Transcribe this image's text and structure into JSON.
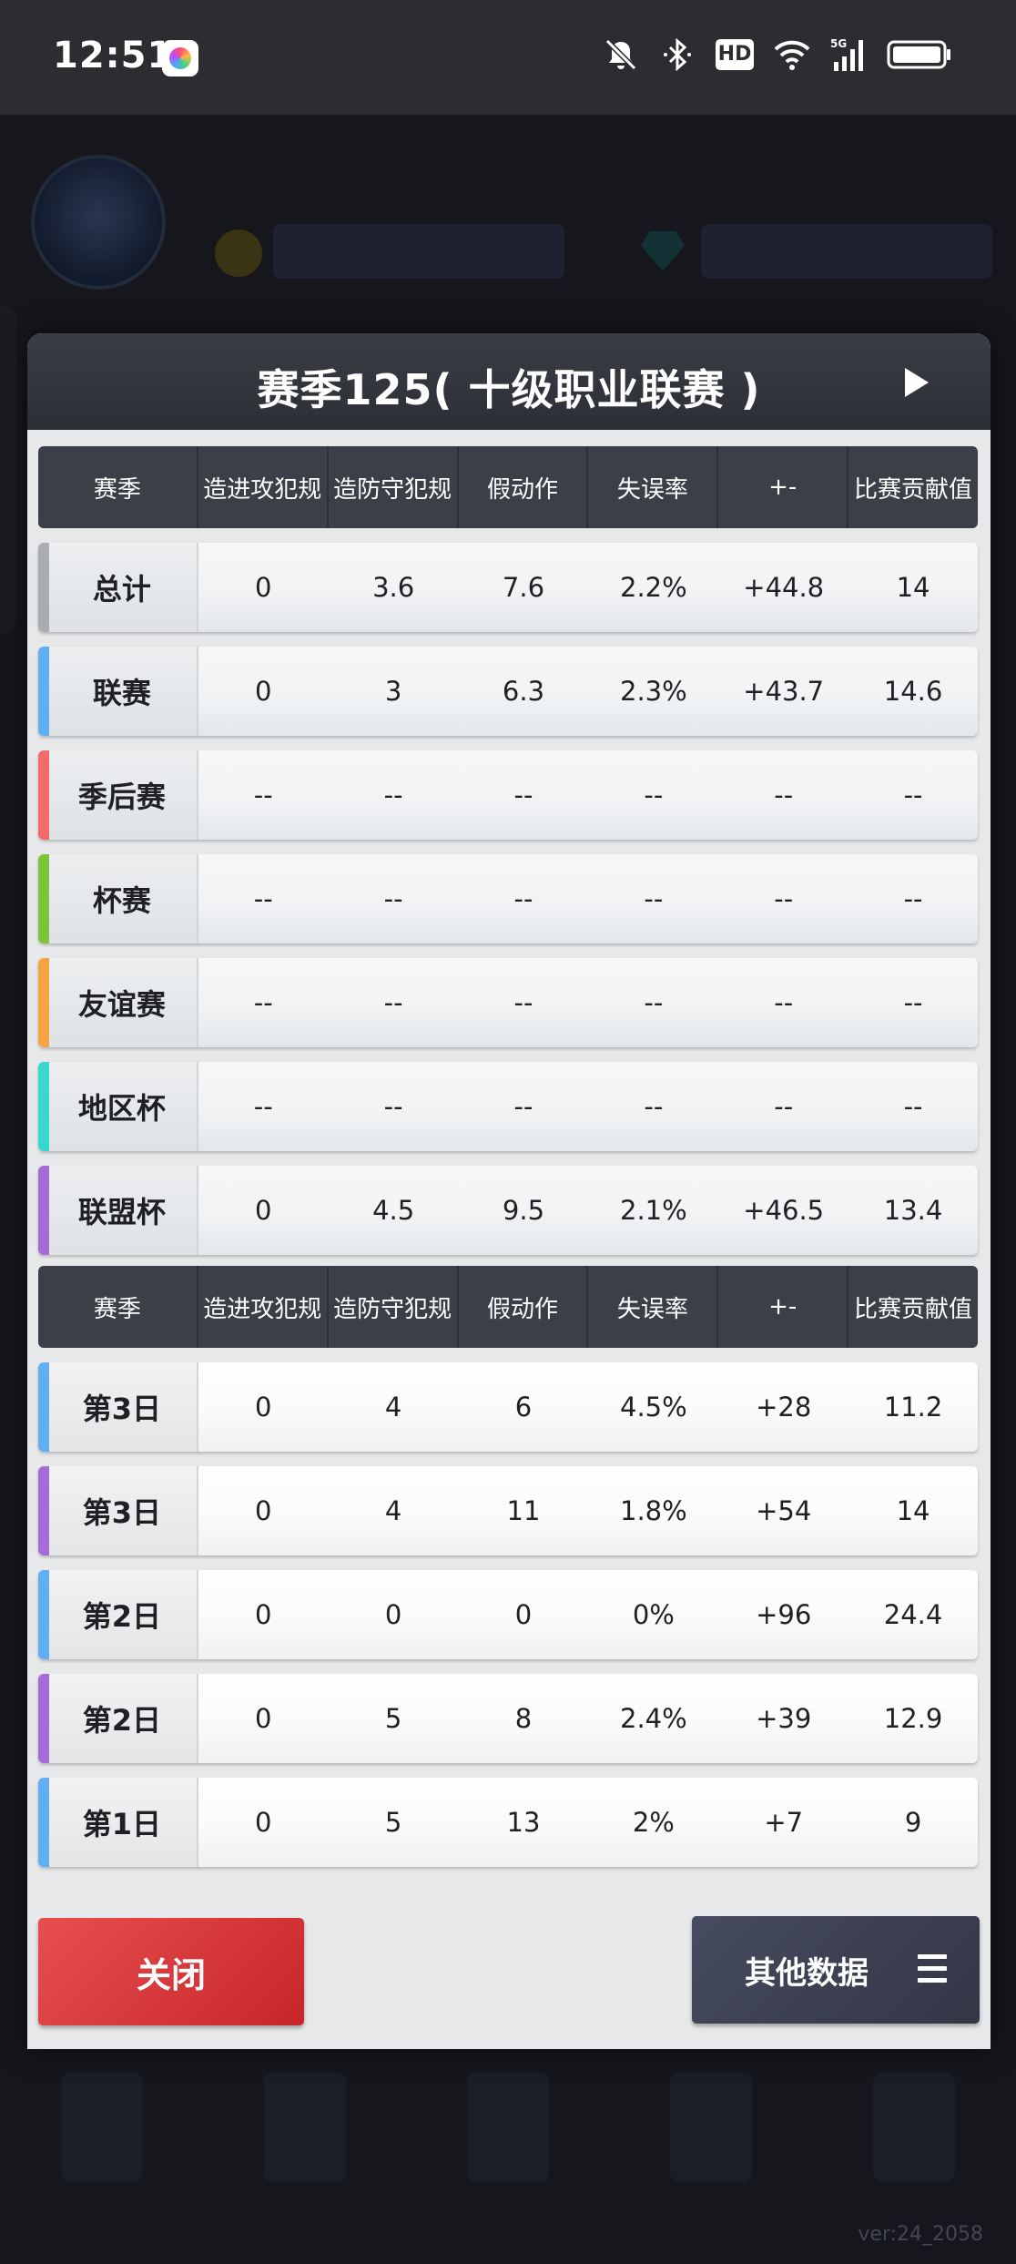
{
  "status_bar": {
    "time": "12:51",
    "icons": [
      "app-icon",
      "mute-icon",
      "bluetooth-icon",
      "hd-icon",
      "wifi-icon",
      "signal-5g-icon",
      "battery-icon"
    ],
    "hd_label": "HD",
    "network": "5G"
  },
  "dialog": {
    "title": "赛季125( 十级职业联赛 )",
    "columns": [
      "赛季",
      "造进攻犯规",
      "造防守犯规",
      "假动作",
      "失误率",
      "+-",
      "比赛贡献值"
    ],
    "season_rows": [
      {
        "label": "总计",
        "color": "#a9acb0",
        "values": [
          "0",
          "3.6",
          "7.6",
          "2.2%",
          "+44.8",
          "14"
        ]
      },
      {
        "label": "联赛",
        "color": "#62aef5",
        "values": [
          "0",
          "3",
          "6.3",
          "2.3%",
          "+43.7",
          "14.6"
        ]
      },
      {
        "label": "季后赛",
        "color": "#f06b6b",
        "values": [
          "--",
          "--",
          "--",
          "--",
          "--",
          "--"
        ]
      },
      {
        "label": "杯赛",
        "color": "#7cc53a",
        "values": [
          "--",
          "--",
          "--",
          "--",
          "--",
          "--"
        ]
      },
      {
        "label": "友谊赛",
        "color": "#f5a443",
        "values": [
          "--",
          "--",
          "--",
          "--",
          "--",
          "--"
        ]
      },
      {
        "label": "地区杯",
        "color": "#36d8d0",
        "values": [
          "--",
          "--",
          "--",
          "--",
          "--",
          "--"
        ]
      },
      {
        "label": "联盟杯",
        "color": "#a66cd6",
        "values": [
          "0",
          "4.5",
          "9.5",
          "2.1%",
          "+46.5",
          "13.4"
        ]
      }
    ],
    "game_rows": [
      {
        "label": "第3日",
        "color": "#62aef5",
        "values": [
          "0",
          "4",
          "6",
          "4.5%",
          "+28",
          "11.2"
        ]
      },
      {
        "label": "第3日",
        "color": "#a66cd6",
        "values": [
          "0",
          "4",
          "11",
          "1.8%",
          "+54",
          "14"
        ]
      },
      {
        "label": "第2日",
        "color": "#62aef5",
        "values": [
          "0",
          "0",
          "0",
          "0%",
          "+96",
          "24.4"
        ]
      },
      {
        "label": "第2日",
        "color": "#a66cd6",
        "values": [
          "0",
          "5",
          "8",
          "2.4%",
          "+39",
          "12.9"
        ]
      },
      {
        "label": "第1日",
        "color": "#62aef5",
        "values": [
          "0",
          "5",
          "13",
          "2%",
          "+7",
          "9"
        ]
      }
    ],
    "close_label": "关闭",
    "more_label": "其他数据"
  },
  "background": {
    "version": "ver:24_2058"
  }
}
